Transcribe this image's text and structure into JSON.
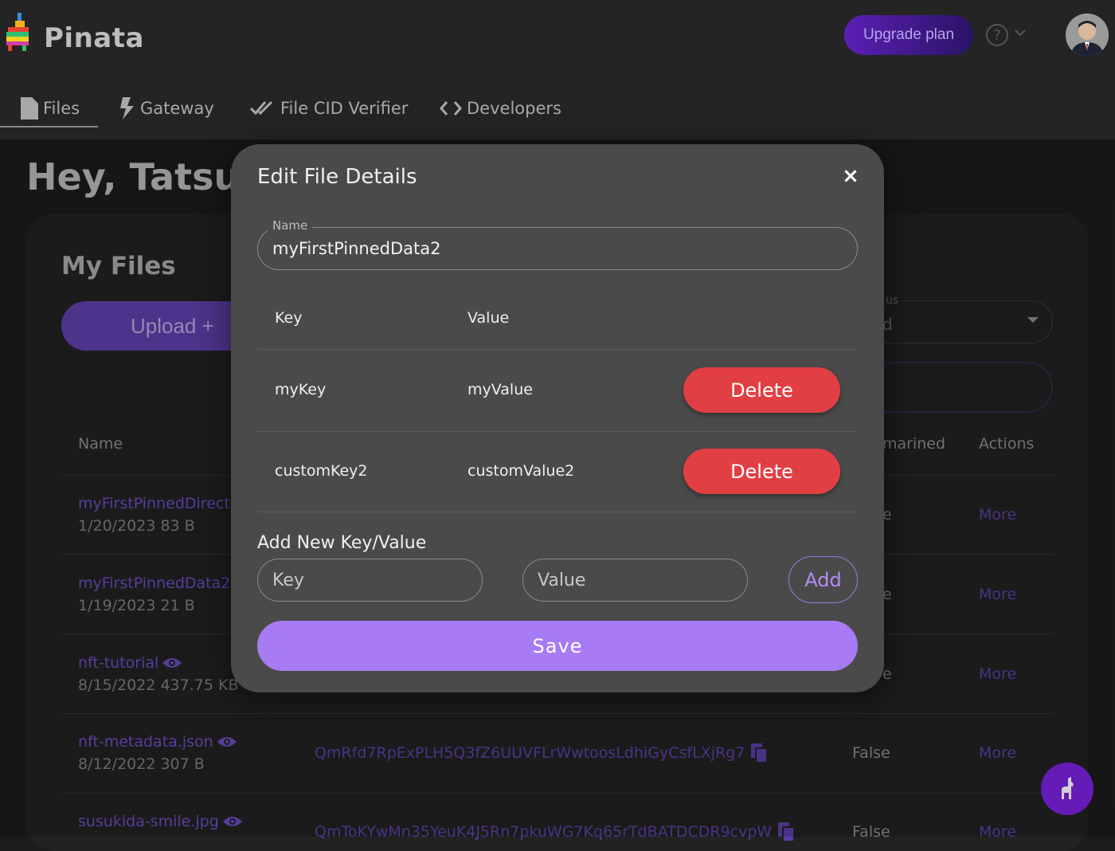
{
  "app": {
    "brand": "Pinata",
    "upgrade_label": "Upgrade plan",
    "help_glyph": "?"
  },
  "nav": {
    "items": [
      {
        "label": "Files",
        "icon": "file-icon"
      },
      {
        "label": "Gateway",
        "icon": "bolt-icon"
      },
      {
        "label": "File CID Verifier",
        "icon": "double-check-icon"
      },
      {
        "label": "Developers",
        "icon": "code-icon"
      }
    ]
  },
  "page": {
    "greeting": "Hey, Tatsuy",
    "my_files_title": "My Files",
    "upload_label": "Upload +",
    "status_label": "us",
    "status_value": "d",
    "table": {
      "headers": {
        "name": "Name",
        "quarantined": "marined",
        "actions": "Actions"
      },
      "rows": [
        {
          "name": "myFirstPinnedDirecto",
          "meta": "1/20/2023 83 B",
          "cid": "",
          "pinned": "e",
          "action": "More"
        },
        {
          "name": "myFirstPinnedData2",
          "meta": "1/19/2023 21 B",
          "cid": "",
          "pinned": "e",
          "action": "More"
        },
        {
          "name": "nft-tutorial",
          "meta": "8/15/2022 437.75 KB",
          "cid": "",
          "pinned": "e",
          "action": "More"
        },
        {
          "name": "nft-metadata.json",
          "meta": "8/12/2022 307 B",
          "cid": "QmRfd7RpExPLH5Q3fZ6UUVFLrWwtoosLdhiGyCsfLXjRg7",
          "pinned": "False",
          "action": "More"
        },
        {
          "name": "susukida-smile.jpg",
          "meta": "",
          "cid": "QmToKYwMn35YeuK4J5Rn7pkuWG7Kq65rTdBATDCDR9cvpW",
          "pinned": "False",
          "action": "More"
        }
      ]
    }
  },
  "modal": {
    "title": "Edit File Details",
    "close_glyph": "×",
    "name_label": "Name",
    "name_value": "myFirstPinnedData2",
    "kv_headers": {
      "key": "Key",
      "value": "Value"
    },
    "kv_rows": [
      {
        "key": "myKey",
        "value": "myValue",
        "delete_label": "Delete"
      },
      {
        "key": "customKey2",
        "value": "customValue2",
        "delete_label": "Delete"
      }
    ],
    "add_title": "Add New Key/Value",
    "key_placeholder": "Key",
    "value_placeholder": "Value",
    "add_label": "Add",
    "save_label": "Save"
  },
  "colors": {
    "accent": "#a77bf3",
    "delete": "#e23f44",
    "modal_bg": "#4a4a4a",
    "page_bg": "#1c1c1c"
  }
}
